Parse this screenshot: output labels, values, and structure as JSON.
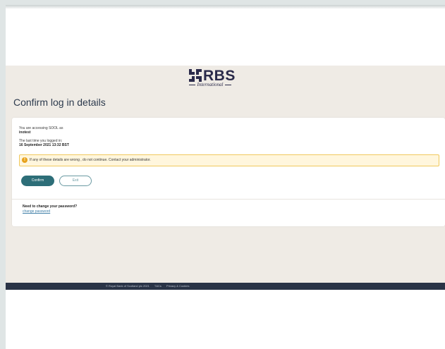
{
  "brand": {
    "name": "RBS",
    "sub": "International",
    "color": "#2a2a4a"
  },
  "page": {
    "title": "Confirm log in details"
  },
  "details": {
    "accessing_label": "You are accessing SOOL as",
    "user": "inotest",
    "last_login_label": "The last time you logged in:",
    "last_login_value": "16 September 2021 13:32 BST"
  },
  "warning": {
    "icon": "info-icon",
    "text": "If any of these details are wrong , do not continue. Contact your administrator."
  },
  "buttons": {
    "confirm": "Confirm",
    "exit": "Exit"
  },
  "password": {
    "heading": "Need to change your password?",
    "link": "change password"
  },
  "footer": {
    "copyright": "© Royal Bank of Scotland plc 2021",
    "links": [
      "T&Cs",
      "Privacy & Cookies"
    ]
  },
  "colors": {
    "background_band": "#efebe5",
    "accent": "#2d6e78",
    "warning_bg": "#fff6dd",
    "warning_border": "#f0c95d",
    "footer_bg": "#2a3447"
  }
}
